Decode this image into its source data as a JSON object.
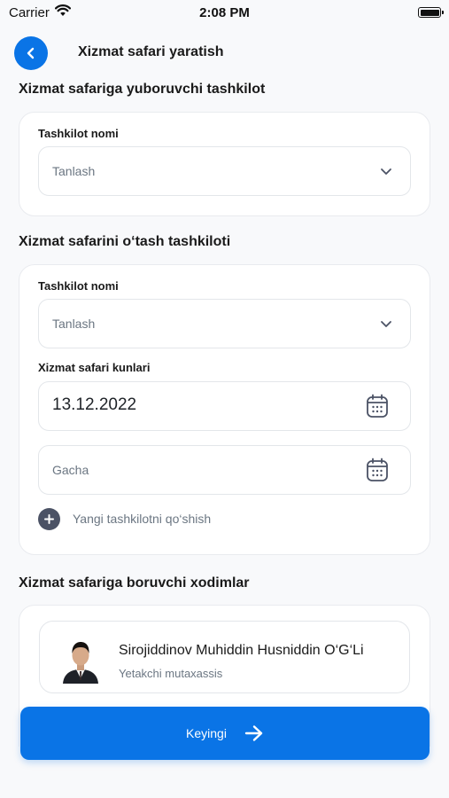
{
  "status_bar": {
    "carrier": "Carrier",
    "time": "2:08 PM"
  },
  "header": {
    "title": "Xizmat safari yaratish",
    "back_icon": "chevron-left-icon"
  },
  "section_sender": {
    "title": "Xizmat safariga yuboruvchi tashkilot",
    "org_label": "Tashkilot nomi",
    "org_select": "Tanlash"
  },
  "section_host": {
    "title": "Xizmat safarini o‘tash tashkiloti",
    "org_label": "Tashkilot nomi",
    "org_select": "Tanlash",
    "days_label": "Xizmat safari kunlari",
    "date_from": "13.12.2022",
    "date_to_placeholder": "Gacha",
    "add_org": "Yangi tashkilotni qo‘shish"
  },
  "section_employees": {
    "title": "Xizmat safariga boruvchi xodimlar",
    "employees": [
      {
        "name": "Sirojiddinov Muhiddin Husniddin O‘G‘Li",
        "role": "Yetakchi mutaxassis"
      }
    ]
  },
  "footer": {
    "next_label": "Keyingi",
    "next_icon": "arrow-right-icon"
  },
  "colors": {
    "accent": "#0a74e6",
    "muted_text": "#6b7682",
    "background": "#f8f9fb"
  }
}
